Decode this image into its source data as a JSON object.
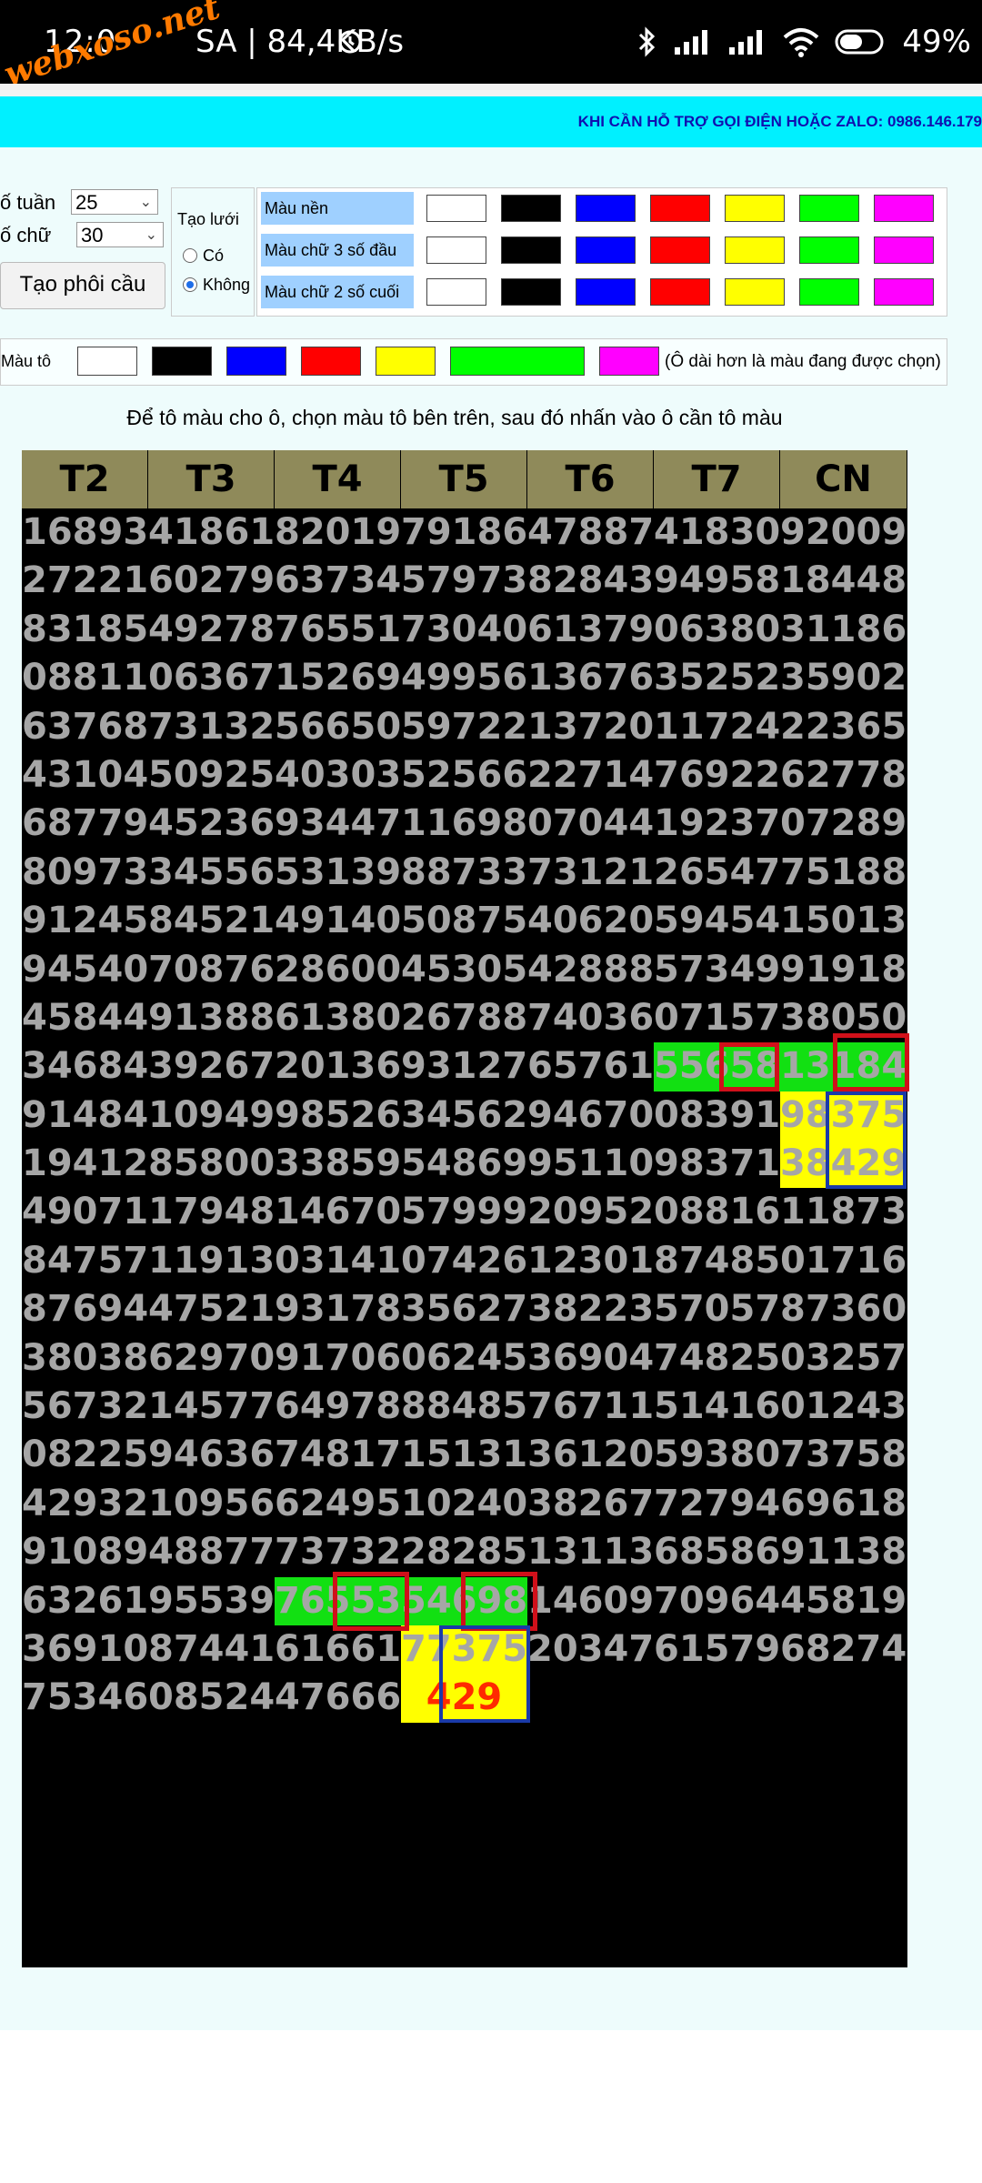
{
  "status_bar": {
    "time": "12:0",
    "speed": "SA | 84,4KB/s",
    "battery": "49%",
    "icons": [
      "alarm-icon",
      "bluetooth-icon",
      "signal-icon",
      "signal-icon",
      "wifi-icon",
      "battery-icon"
    ]
  },
  "watermark": "webxoso.net",
  "banner": {
    "text": "KHI CẦN HỖ TRỢ GỌI ĐIỆN HOẶC ZALO: 0986.146.179"
  },
  "settings": {
    "weeks_label": "ố tuần",
    "weeks_value": "25",
    "digits_label": "ố chữ",
    "digits_value": "30",
    "create_button": "Tạo phôi cầu",
    "grid_label": "Tạo lưới",
    "grid_yes": "Có",
    "grid_no": "Không",
    "color_rows": [
      "Màu nền",
      "Màu chữ 3 số đầu",
      "Màu chữ 2 số cuối"
    ],
    "palette": [
      "#ffffff",
      "#000000",
      "#0000ff",
      "#ff0000",
      "#ffff00",
      "#00ff00",
      "#ff00ff"
    ],
    "paint_label": "Màu tô",
    "paint_note": "(Ô dài hơn là màu đang được chọn)",
    "selected_paint": "#00ff00"
  },
  "instruction": "Để tô màu cho ô, chọn màu tô bên trên, sau đó nhấn vào ô cần tô màu",
  "table": {
    "headers": [
      "T2",
      "T3",
      "T4",
      "T5",
      "T6",
      "T7",
      "CN"
    ],
    "rows": [
      [
        "16893",
        "41861",
        "82019",
        "79186",
        "47887",
        "41830",
        "92009"
      ],
      [
        "27221",
        "60279",
        "63734",
        "57973",
        "82843",
        "94958",
        "18448"
      ],
      [
        "83185",
        "49278",
        "76551",
        "73040",
        "61379",
        "06380",
        "31186"
      ],
      [
        "08811",
        "06367",
        "15269",
        "49956",
        "13676",
        "35252",
        "35902"
      ],
      [
        "63768",
        "73132",
        "56650",
        "59722",
        "13720",
        "11724",
        "22365"
      ],
      [
        "43104",
        "50925",
        "40303",
        "52566",
        "22714",
        "76922",
        "62778"
      ],
      [
        "68779",
        "45236",
        "93447",
        "11698",
        "07044",
        "19237",
        "07289"
      ],
      [
        "80973",
        "34556",
        "53139",
        "88733",
        "73121",
        "26547",
        "75188"
      ],
      [
        "91245",
        "84521",
        "49140",
        "50875",
        "40620",
        "59454",
        "15013"
      ],
      [
        "94540",
        "70876",
        "28600",
        "45305",
        "42888",
        "57349",
        "91918"
      ],
      [
        "45844",
        "91388",
        "61380",
        "26788",
        "74036",
        "07157",
        "38050"
      ],
      [
        "34684",
        "39267",
        "20136",
        "93127",
        "65761",
        "55658",
        "13184"
      ],
      [
        "91484",
        "10949",
        "98526",
        "34562",
        "94670",
        "08391",
        "98375"
      ],
      [
        "19412",
        "85800",
        "33859",
        "54869",
        "95110",
        "98371",
        "38429"
      ],
      [
        "49071",
        "17948",
        "14670",
        "57999",
        "20952",
        "08816",
        "11873"
      ],
      [
        "84757",
        "11913",
        "03141",
        "07426",
        "12301",
        "87485",
        "01716"
      ],
      [
        "87694",
        "47521",
        "93178",
        "35627",
        "38223",
        "57057",
        "87360"
      ],
      [
        "38038",
        "62970",
        "91706",
        "06245",
        "36904",
        "74825",
        "03257"
      ],
      [
        "56732",
        "14577",
        "64978",
        "88485",
        "76711",
        "51416",
        "01243"
      ],
      [
        "08225",
        "94636",
        "74817",
        "15131",
        "36120",
        "59380",
        "73758"
      ],
      [
        "42932",
        "10956",
        "62495",
        "10240",
        "38267",
        "72794",
        "69618"
      ],
      [
        "91089",
        "48877",
        "73732",
        "28285",
        "13113",
        "68586",
        "91138"
      ],
      [
        "63261",
        "95539",
        "76553",
        "54698",
        "14609",
        "70964",
        "45819"
      ],
      [
        "36910",
        "87441",
        "61661",
        "77375",
        "20347",
        "61579",
        "68274"
      ],
      [
        "75346",
        "08524",
        "47666",
        "429",
        "",
        "",
        ""
      ]
    ]
  }
}
